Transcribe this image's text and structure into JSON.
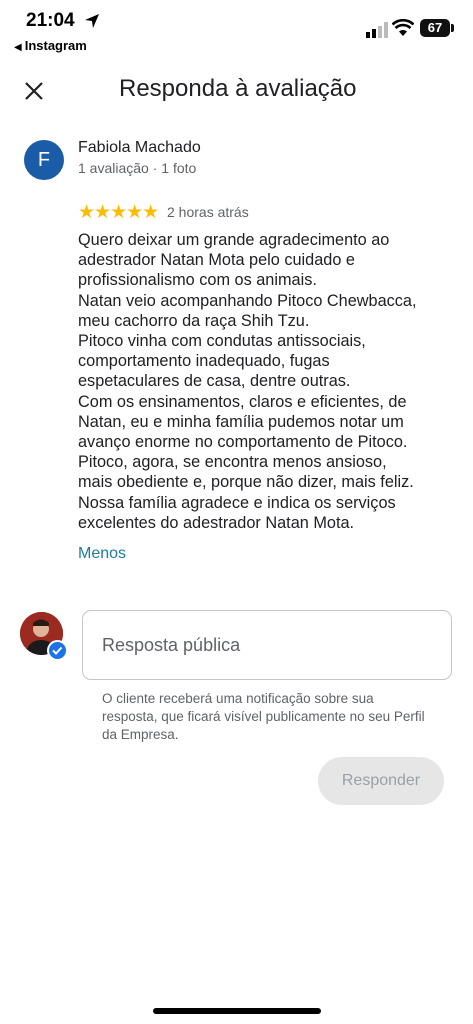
{
  "status_bar": {
    "time": "21:04",
    "back_app": "Instagram",
    "battery": "67"
  },
  "header": {
    "title": "Responda à avaliação"
  },
  "review": {
    "avatar_letter": "F",
    "reviewer_name": "Fabiola Machado",
    "reviewer_meta": "1 avaliação · 1 foto",
    "rating": 5,
    "stars": "★★★★★",
    "time": "2 horas atrás",
    "text_lines": [
      "Quero deixar um grande agradecimento ao",
      "adestrador Natan Mota pelo cuidado e",
      "profissionalismo com os animais.",
      "Natan veio acompanhando Pitoco Chewbacca,",
      "meu cachorro da raça Shih Tzu.",
      "Pitoco vinha com condutas antissociais,",
      "comportamento inadequado, fugas",
      "espetaculares de casa, dentre outras.",
      "Com os ensinamentos, claros e eficientes, de",
      "Natan, eu e minha família pudemos notar um",
      "avanço enorme no comportamento de Pitoco.",
      "Pitoco, agora, se encontra menos ansioso,",
      "mais obediente e, porque não dizer, mais feliz.",
      "Nossa família agradece e indica os serviços",
      "excelentes do adestrador Natan Mota."
    ],
    "less_link": "Menos"
  },
  "reply": {
    "placeholder": "Resposta pública",
    "value": "",
    "notice": "O cliente receberá uma notificação sobre sua resposta, que ficará visível publicamente no seu Perfil da Empresa.",
    "button_label": "Responder"
  },
  "colors": {
    "accent_link": "#1e7d9c",
    "star": "#fbbc04",
    "avatar_bg": "#1a5ca8",
    "verified": "#1a73e8"
  }
}
